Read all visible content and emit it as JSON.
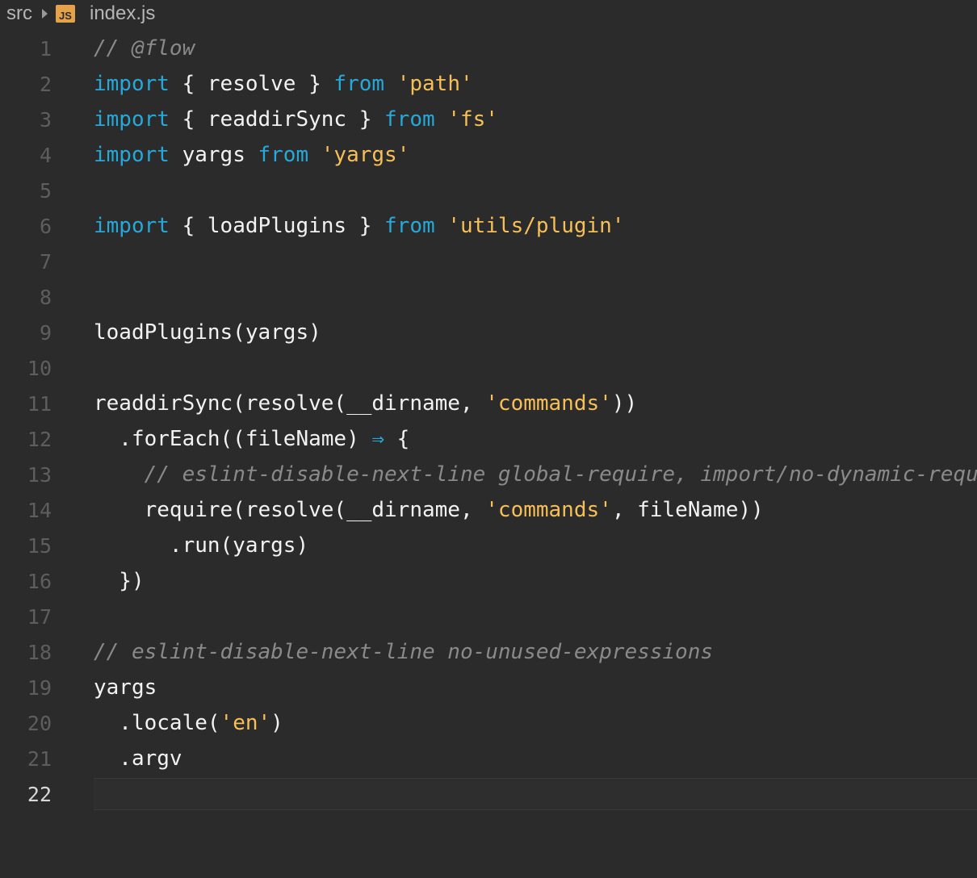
{
  "breadcrumb": {
    "folder": "src",
    "file_icon_label": "JS",
    "file": "index.js"
  },
  "colors": {
    "background": "#2b2b2b",
    "keyword": "#26a8d8",
    "string": "#f7bf57",
    "comment": "#8a8a8a",
    "text": "#f2f2f2",
    "js_icon": "#e6a24a"
  },
  "editor": {
    "current_line": 22,
    "lines": [
      {
        "n": "1",
        "tokens": [
          {
            "t": "// @flow",
            "c": "cm"
          }
        ]
      },
      {
        "n": "2",
        "tokens": [
          {
            "t": "import",
            "c": "kw"
          },
          {
            "t": " { resolve } ",
            "c": "pl"
          },
          {
            "t": "from",
            "c": "kw"
          },
          {
            "t": " ",
            "c": "pl"
          },
          {
            "t": "'path'",
            "c": "str"
          }
        ]
      },
      {
        "n": "3",
        "tokens": [
          {
            "t": "import",
            "c": "kw"
          },
          {
            "t": " { readdirSync } ",
            "c": "pl"
          },
          {
            "t": "from",
            "c": "kw"
          },
          {
            "t": " ",
            "c": "pl"
          },
          {
            "t": "'fs'",
            "c": "str"
          }
        ]
      },
      {
        "n": "4",
        "tokens": [
          {
            "t": "import",
            "c": "kw"
          },
          {
            "t": " yargs ",
            "c": "pl"
          },
          {
            "t": "from",
            "c": "kw"
          },
          {
            "t": " ",
            "c": "pl"
          },
          {
            "t": "'yargs'",
            "c": "str"
          }
        ]
      },
      {
        "n": "5",
        "tokens": []
      },
      {
        "n": "6",
        "tokens": [
          {
            "t": "import",
            "c": "kw"
          },
          {
            "t": " { loadPlugins } ",
            "c": "pl"
          },
          {
            "t": "from",
            "c": "kw"
          },
          {
            "t": " ",
            "c": "pl"
          },
          {
            "t": "'utils/plugin'",
            "c": "str"
          }
        ]
      },
      {
        "n": "7",
        "tokens": []
      },
      {
        "n": "8",
        "tokens": []
      },
      {
        "n": "9",
        "tokens": [
          {
            "t": "loadPlugins(yargs)",
            "c": "pl"
          }
        ]
      },
      {
        "n": "10",
        "tokens": []
      },
      {
        "n": "11",
        "tokens": [
          {
            "t": "readdirSync(resolve(__dirname, ",
            "c": "pl"
          },
          {
            "t": "'commands'",
            "c": "str"
          },
          {
            "t": "))",
            "c": "pl"
          }
        ]
      },
      {
        "n": "12",
        "tokens": [
          {
            "t": "  .forEach((fileName) ",
            "c": "pl"
          },
          {
            "t": "⇒",
            "c": "kw"
          },
          {
            "t": " {",
            "c": "pl"
          }
        ]
      },
      {
        "n": "13",
        "tokens": [
          {
            "t": "    ",
            "c": "pl"
          },
          {
            "t": "// eslint-disable-next-line global-require, import/no-dynamic-require",
            "c": "cm"
          }
        ]
      },
      {
        "n": "14",
        "tokens": [
          {
            "t": "    require(resolve(__dirname, ",
            "c": "pl"
          },
          {
            "t": "'commands'",
            "c": "str"
          },
          {
            "t": ", fileName))",
            "c": "pl"
          }
        ]
      },
      {
        "n": "15",
        "tokens": [
          {
            "t": "      .run(yargs)",
            "c": "pl"
          }
        ]
      },
      {
        "n": "16",
        "tokens": [
          {
            "t": "  })",
            "c": "pl"
          }
        ]
      },
      {
        "n": "17",
        "tokens": []
      },
      {
        "n": "18",
        "tokens": [
          {
            "t": "// eslint-disable-next-line no-unused-expressions",
            "c": "cm"
          }
        ]
      },
      {
        "n": "19",
        "tokens": [
          {
            "t": "yargs",
            "c": "pl"
          }
        ]
      },
      {
        "n": "20",
        "tokens": [
          {
            "t": "  .locale(",
            "c": "pl"
          },
          {
            "t": "'en'",
            "c": "str"
          },
          {
            "t": ")",
            "c": "pl"
          }
        ]
      },
      {
        "n": "21",
        "tokens": [
          {
            "t": "  .argv",
            "c": "pl"
          }
        ]
      },
      {
        "n": "22",
        "tokens": []
      }
    ]
  }
}
